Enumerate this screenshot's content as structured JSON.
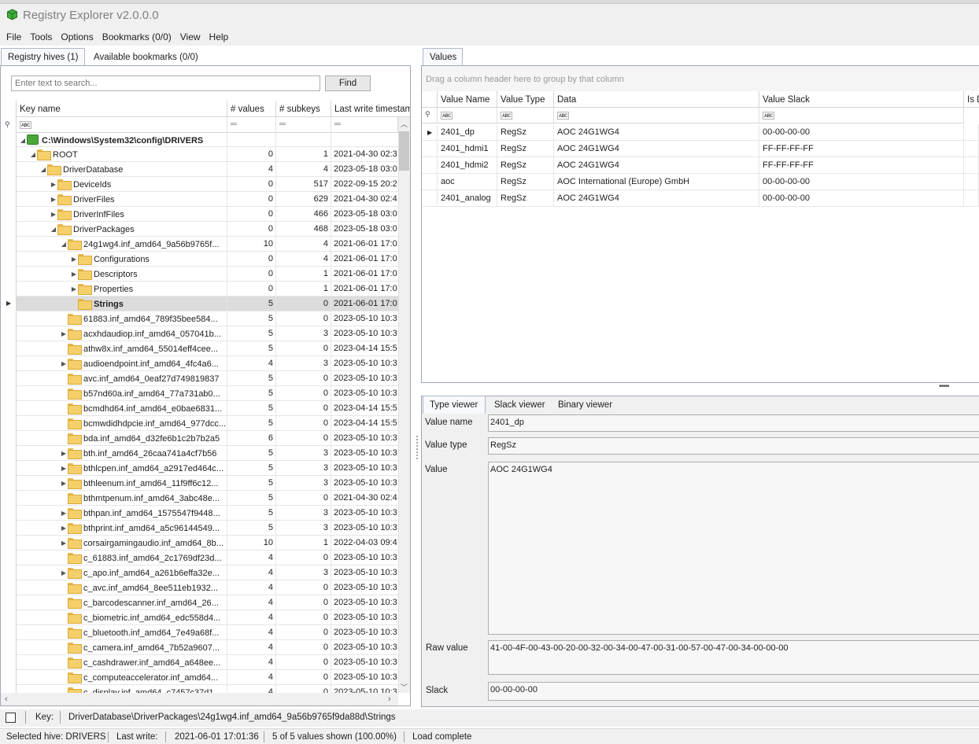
{
  "app": {
    "title": "Registry Explorer v2.0.0.0"
  },
  "menu": [
    "File",
    "Tools",
    "Options",
    "Bookmarks (0/0)",
    "View",
    "Help"
  ],
  "left_tabs": [
    "Registry hives (1)",
    "Available bookmarks (0/0)"
  ],
  "search": {
    "placeholder": "Enter text to search...",
    "button": "Find"
  },
  "tree_columns": [
    "Key name",
    "# values",
    "# subkeys",
    "Last write timestamp"
  ],
  "tree_rows": [
    {
      "name": "C:\\Windows\\System32\\config\\DRIVERS",
      "values": "",
      "subkeys": "",
      "ts": "",
      "depth": 0,
      "exp": "◢",
      "icon": "hive",
      "bold": true
    },
    {
      "name": "ROOT",
      "values": "0",
      "subkeys": "1",
      "ts": "2021-04-30 02:3",
      "depth": 1,
      "exp": "◢",
      "icon": "folder"
    },
    {
      "name": "DriverDatabase",
      "values": "4",
      "subkeys": "4",
      "ts": "2023-05-18 03:0",
      "depth": 2,
      "exp": "◢",
      "icon": "folder"
    },
    {
      "name": "DeviceIds",
      "values": "0",
      "subkeys": "517",
      "ts": "2022-09-15 20:2",
      "depth": 3,
      "exp": "▶",
      "icon": "folder"
    },
    {
      "name": "DriverFiles",
      "values": "0",
      "subkeys": "629",
      "ts": "2021-04-30 02:4",
      "depth": 3,
      "exp": "▶",
      "icon": "folder"
    },
    {
      "name": "DriverInfFiles",
      "values": "0",
      "subkeys": "466",
      "ts": "2023-05-18 03:0",
      "depth": 3,
      "exp": "▶",
      "icon": "folder"
    },
    {
      "name": "DriverPackages",
      "values": "0",
      "subkeys": "468",
      "ts": "2023-05-18 03:0",
      "depth": 3,
      "exp": "◢",
      "icon": "folder"
    },
    {
      "name": "24g1wg4.inf_amd64_9a56b9765f...",
      "values": "10",
      "subkeys": "4",
      "ts": "2021-06-01 17:0",
      "depth": 4,
      "exp": "◢",
      "icon": "folder"
    },
    {
      "name": "Configurations",
      "values": "0",
      "subkeys": "4",
      "ts": "2021-06-01 17:0",
      "depth": 5,
      "exp": "▶",
      "icon": "folder"
    },
    {
      "name": "Descriptors",
      "values": "0",
      "subkeys": "1",
      "ts": "2021-06-01 17:0",
      "depth": 5,
      "exp": "▶",
      "icon": "folder"
    },
    {
      "name": "Properties",
      "values": "0",
      "subkeys": "1",
      "ts": "2021-06-01 17:0",
      "depth": 5,
      "exp": "▶",
      "icon": "folder"
    },
    {
      "name": "Strings",
      "values": "5",
      "subkeys": "0",
      "ts": "2021-06-01 17:0",
      "depth": 5,
      "exp": "",
      "icon": "folder",
      "bold": true,
      "selected": true
    },
    {
      "name": "61883.inf_amd64_789f35bee584...",
      "values": "5",
      "subkeys": "0",
      "ts": "2023-05-10 10:3",
      "depth": 4,
      "exp": "",
      "icon": "folder"
    },
    {
      "name": "acxhdaudiop.inf_amd64_057041b...",
      "values": "5",
      "subkeys": "3",
      "ts": "2023-05-10 10:3",
      "depth": 4,
      "exp": "▶",
      "icon": "folder"
    },
    {
      "name": "athw8x.inf_amd64_55014eff4cee...",
      "values": "5",
      "subkeys": "0",
      "ts": "2023-04-14 15:5",
      "depth": 4,
      "exp": "",
      "icon": "folder"
    },
    {
      "name": "audioendpoint.inf_amd64_4fc4a6...",
      "values": "4",
      "subkeys": "3",
      "ts": "2023-05-10 10:3",
      "depth": 4,
      "exp": "▶",
      "icon": "folder"
    },
    {
      "name": "avc.inf_amd64_0eaf27d749819837",
      "values": "5",
      "subkeys": "0",
      "ts": "2023-05-10 10:3",
      "depth": 4,
      "exp": "",
      "icon": "folder"
    },
    {
      "name": "b57nd60a.inf_amd64_77a731ab0...",
      "values": "5",
      "subkeys": "0",
      "ts": "2023-05-10 10:3",
      "depth": 4,
      "exp": "",
      "icon": "folder"
    },
    {
      "name": "bcmdhd64.inf_amd64_e0bae6831...",
      "values": "5",
      "subkeys": "0",
      "ts": "2023-04-14 15:5",
      "depth": 4,
      "exp": "",
      "icon": "folder"
    },
    {
      "name": "bcmwdidhdpcie.inf_amd64_977dcc...",
      "values": "5",
      "subkeys": "0",
      "ts": "2023-04-14 15:5",
      "depth": 4,
      "exp": "",
      "icon": "folder"
    },
    {
      "name": "bda.inf_amd64_d32fe6b1c2b7b2a5",
      "values": "6",
      "subkeys": "0",
      "ts": "2023-05-10 10:3",
      "depth": 4,
      "exp": "",
      "icon": "folder"
    },
    {
      "name": "bth.inf_amd64_26caa741a4cf7b56",
      "values": "5",
      "subkeys": "3",
      "ts": "2023-05-10 10:3",
      "depth": 4,
      "exp": "▶",
      "icon": "folder"
    },
    {
      "name": "bthlcpen.inf_amd64_a2917ed464c...",
      "values": "5",
      "subkeys": "3",
      "ts": "2023-05-10 10:3",
      "depth": 4,
      "exp": "▶",
      "icon": "folder"
    },
    {
      "name": "bthleenum.inf_amd64_11f9ff6c12...",
      "values": "5",
      "subkeys": "3",
      "ts": "2023-05-10 10:3",
      "depth": 4,
      "exp": "▶",
      "icon": "folder"
    },
    {
      "name": "bthmtpenum.inf_amd64_3abc48e...",
      "values": "5",
      "subkeys": "0",
      "ts": "2021-04-30 02:4",
      "depth": 4,
      "exp": "",
      "icon": "folder"
    },
    {
      "name": "bthpan.inf_amd64_1575547f9448...",
      "values": "5",
      "subkeys": "3",
      "ts": "2023-05-10 10:3",
      "depth": 4,
      "exp": "▶",
      "icon": "folder"
    },
    {
      "name": "bthprint.inf_amd64_a5c96144549...",
      "values": "5",
      "subkeys": "3",
      "ts": "2023-05-10 10:3",
      "depth": 4,
      "exp": "▶",
      "icon": "folder"
    },
    {
      "name": "corsairgamingaudio.inf_amd64_8b...",
      "values": "10",
      "subkeys": "1",
      "ts": "2022-04-03 09:4",
      "depth": 4,
      "exp": "▶",
      "icon": "folder"
    },
    {
      "name": "c_61883.inf_amd64_2c1769df23d...",
      "values": "4",
      "subkeys": "0",
      "ts": "2023-05-10 10:3",
      "depth": 4,
      "exp": "",
      "icon": "folder"
    },
    {
      "name": "c_apo.inf_amd64_a261b6effa32e...",
      "values": "4",
      "subkeys": "3",
      "ts": "2023-05-10 10:3",
      "depth": 4,
      "exp": "▶",
      "icon": "folder"
    },
    {
      "name": "c_avc.inf_amd64_8ee511eb1932...",
      "values": "4",
      "subkeys": "0",
      "ts": "2023-05-10 10:3",
      "depth": 4,
      "exp": "",
      "icon": "folder"
    },
    {
      "name": "c_barcodescanner.inf_amd64_26...",
      "values": "4",
      "subkeys": "0",
      "ts": "2023-05-10 10:3",
      "depth": 4,
      "exp": "",
      "icon": "folder"
    },
    {
      "name": "c_biometric.inf_amd64_edc558d4...",
      "values": "4",
      "subkeys": "0",
      "ts": "2023-05-10 10:3",
      "depth": 4,
      "exp": "",
      "icon": "folder"
    },
    {
      "name": "c_bluetooth.inf_amd64_7e49a68f...",
      "values": "4",
      "subkeys": "0",
      "ts": "2023-05-10 10:3",
      "depth": 4,
      "exp": "",
      "icon": "folder"
    },
    {
      "name": "c_camera.inf_amd64_7b52a9607...",
      "values": "4",
      "subkeys": "0",
      "ts": "2023-05-10 10:3",
      "depth": 4,
      "exp": "",
      "icon": "folder"
    },
    {
      "name": "c_cashdrawer.inf_amd64_a648ee...",
      "values": "4",
      "subkeys": "0",
      "ts": "2023-05-10 10:3",
      "depth": 4,
      "exp": "",
      "icon": "folder"
    },
    {
      "name": "c_computeaccelerator.inf_amd64...",
      "values": "4",
      "subkeys": "0",
      "ts": "2023-05-10 10:3",
      "depth": 4,
      "exp": "",
      "icon": "folder"
    },
    {
      "name": "c_display.inf_amd64_c7457c37d1...",
      "values": "4",
      "subkeys": "0",
      "ts": "2023-05-10 10:3",
      "depth": 4,
      "exp": "",
      "icon": "folder"
    }
  ],
  "values_tab": "Values",
  "values_group_hint": "Drag a column header here to group by that column",
  "values_columns": [
    "Value Name",
    "Value Type",
    "Data",
    "Value Slack",
    "Is D"
  ],
  "values_rows": [
    {
      "name": "2401_dp",
      "type": "RegSz",
      "data": "AOC 24G1WG4",
      "slack": "00-00-00-00"
    },
    {
      "name": "2401_hdmi1",
      "type": "RegSz",
      "data": "AOC 24G1WG4",
      "slack": "FF-FF-FF-FF"
    },
    {
      "name": "2401_hdmi2",
      "type": "RegSz",
      "data": "AOC 24G1WG4",
      "slack": "FF-FF-FF-FF"
    },
    {
      "name": "aoc",
      "type": "RegSz",
      "data": "AOC International (Europe) GmbH",
      "slack": "00-00-00-00"
    },
    {
      "name": "2401_analog",
      "type": "RegSz",
      "data": "AOC 24G1WG4",
      "slack": "00-00-00-00"
    }
  ],
  "viewer_tabs": [
    "Type viewer",
    "Slack viewer",
    "Binary viewer"
  ],
  "viewer": {
    "value_name_label": "Value name",
    "value_name": "2401_dp",
    "value_type_label": "Value type",
    "value_type": "RegSz",
    "value_label": "Value",
    "value": "AOC 24G1WG4",
    "raw_label": "Raw value",
    "raw": "41-00-4F-00-43-00-20-00-32-00-34-00-47-00-31-00-57-00-47-00-34-00-00-00",
    "slack_label": "Slack",
    "slack": "00-00-00-00"
  },
  "key_bar": {
    "label": "Key:",
    "path": "DriverDatabase\\DriverPackages\\24g1wg4.inf_amd64_9a56b9765f9da88d\\Strings"
  },
  "status": {
    "hive": "Selected hive: DRIVERS",
    "last_write_label": "Last write:",
    "last_write": "2021-06-01 17:01:36",
    "shown": "5 of 5 values shown (100.00%)",
    "load": "Load complete"
  },
  "colors": {
    "accent_border": "#9fa8b4",
    "selection": "#dcdcdc",
    "folder": "#f5cf6a",
    "hive_icon": "#4aa83a"
  }
}
